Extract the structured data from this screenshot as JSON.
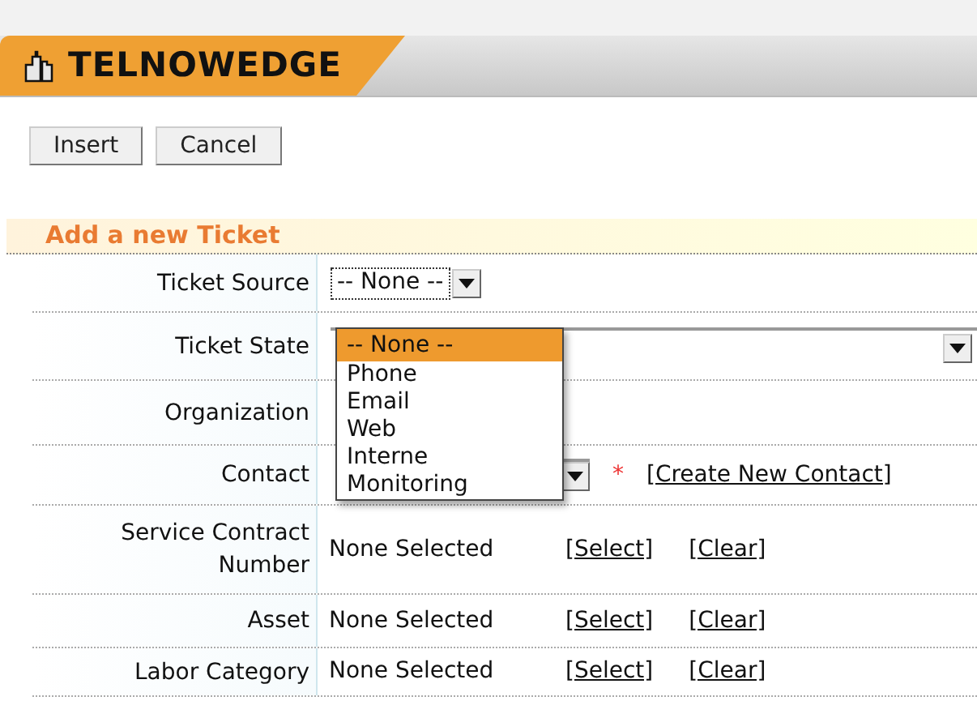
{
  "header": {
    "title": "TELNOWEDGE"
  },
  "buttons": [
    "Insert",
    "Cancel"
  ],
  "section": {
    "title": "Add a new Ticket"
  },
  "fields": [
    {
      "kind": "select",
      "label": "Ticket Source",
      "value": "-- None --",
      "focused": true
    },
    {
      "kind": "wide_select",
      "label": "Ticket State"
    },
    {
      "kind": "plain",
      "label": "Organization"
    },
    {
      "kind": "contact",
      "label": "Contact",
      "required": "*",
      "link": "[Create New Contact]"
    },
    {
      "kind": "picker",
      "label": "Service Contract Number",
      "value": "None Selected",
      "links": [
        "[Select]",
        "[Clear]"
      ]
    },
    {
      "kind": "picker",
      "label": "Asset",
      "value": "None Selected",
      "links": [
        "[Select]",
        "[Clear]"
      ]
    },
    {
      "kind": "picker",
      "label": "Labor Category",
      "value": "None Selected",
      "links": [
        "[Select]",
        "[Clear]"
      ]
    }
  ],
  "dropdown": {
    "options": [
      {
        "label": "-- None --",
        "selected": true
      },
      {
        "label": "Phone",
        "selected": false
      },
      {
        "label": "Email",
        "selected": false
      },
      {
        "label": "Web",
        "selected": false
      },
      {
        "label": "Interne",
        "selected": false
      },
      {
        "label": "Monitoring",
        "selected": false
      }
    ]
  }
}
